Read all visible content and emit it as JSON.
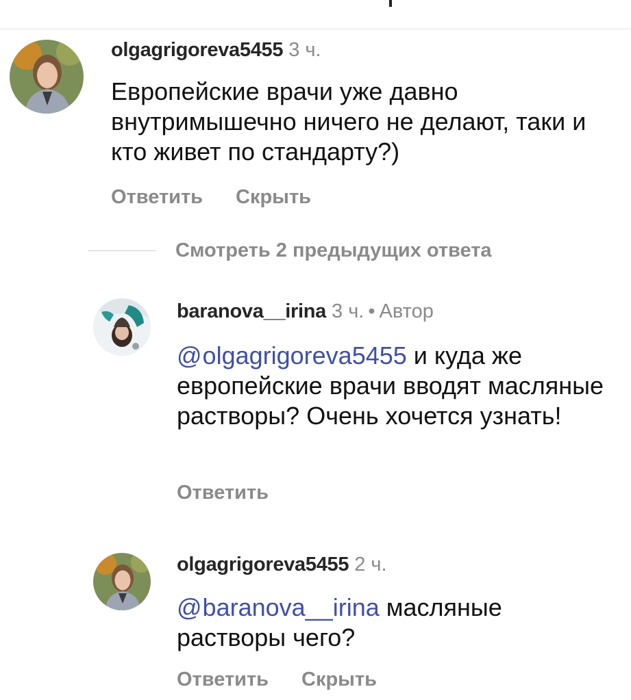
{
  "comments": [
    {
      "username": "olgagrigoreva5455",
      "time": "3 ч.",
      "text": "Европейские врачи уже давно внутримышечно ничего не делают, таки и кто живет по стандарту?)",
      "actions": [
        "Ответить",
        "Скрыть"
      ]
    },
    {
      "username": "baranova__irina",
      "time": "3 ч.",
      "author_tag": "Автор",
      "mention": "olgagrigoreva5455",
      "text": "и куда же европейские врачи вводят масляные растворы? Очень хочется узнать!",
      "actions": [
        "Ответить"
      ]
    },
    {
      "username": "olgagrigoreva5455",
      "time": "2 ч.",
      "mention": "baranova__irina",
      "text": "масляные растворы чего?",
      "actions": [
        "Ответить",
        "Скрыть"
      ]
    }
  ],
  "view_previous_replies": "Смотреть 2 предыдущих ответа",
  "icons": {
    "mention_symbol": "@",
    "avatars": [
      "avatar-olgagrigoreva5455",
      "avatar-baranova__irina",
      "avatar-olgagrigoreva5455"
    ]
  },
  "colors": {
    "mention": "#3f4fa8",
    "secondary_text": "#8a8a8a",
    "primary_text": "#111111"
  }
}
